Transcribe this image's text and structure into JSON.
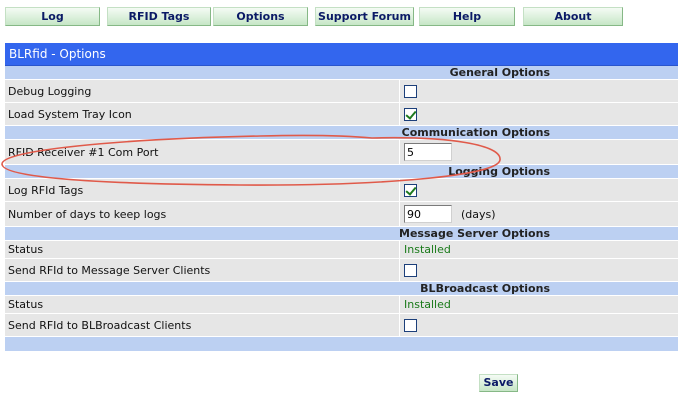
{
  "nav": {
    "items": [
      {
        "label": "Log"
      },
      {
        "label": "RFID Tags"
      },
      {
        "label": "Options"
      },
      {
        "label": "Support Forum"
      },
      {
        "label": "Help"
      },
      {
        "label": "About"
      }
    ]
  },
  "panel": {
    "title": "BLRfid - Options",
    "general": {
      "header": "General Options",
      "debug_logging_label": "Debug Logging",
      "debug_logging_checked": false,
      "tray_icon_label": "Load System Tray Icon",
      "tray_icon_checked": true
    },
    "communication": {
      "header": "Communication Options",
      "com_port_label": "RFID Receiver #1 Com Port",
      "com_port_value": "5"
    },
    "logging": {
      "header": "Logging Options",
      "log_tags_label": "Log RFId Tags",
      "log_tags_checked": true,
      "days_label": "Number of days to keep logs",
      "days_value": "90",
      "days_unit": "(days)"
    },
    "message_server": {
      "header": "Message Server Options",
      "status_label": "Status",
      "status_value": "Installed",
      "send_label": "Send RFId to Message Server Clients",
      "send_checked": false
    },
    "broadcast": {
      "header": "BLBroadcast Options",
      "status_label": "Status",
      "status_value": "Installed",
      "send_label": "Send RFId to BLBroadcast Clients",
      "send_checked": false
    }
  },
  "save_label": "Save",
  "colors": {
    "title_bar": "#3366ee",
    "section_header": "#bcd0f2",
    "row_bg": "#e6e6e6",
    "status_green": "#1a7a1a",
    "annotation_red": "#e05a4a"
  }
}
